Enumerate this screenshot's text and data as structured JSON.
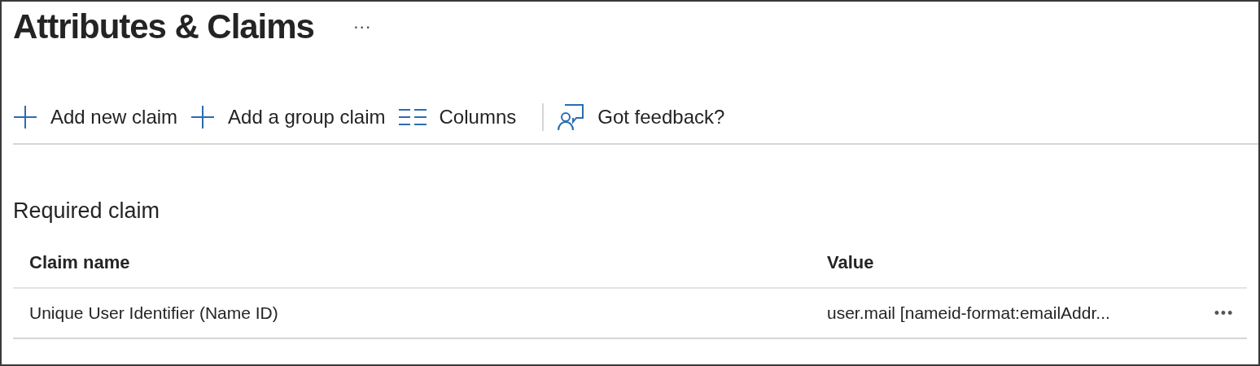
{
  "page": {
    "title": "Attributes & Claims",
    "more_menu": "···"
  },
  "toolbar": [
    {
      "kind": "add",
      "label": "Add new claim"
    },
    {
      "kind": "add",
      "label": "Add a group claim"
    },
    {
      "kind": "columns",
      "label": "Columns"
    },
    {
      "kind": "feedback",
      "label": "Got feedback?"
    }
  ],
  "section": {
    "title": "Required claim"
  },
  "table": {
    "columns": [
      "Claim name",
      "Value"
    ],
    "rows": [
      {
        "cells": [
          "Unique User Identifier (Name ID)",
          "user.mail [nameid-format:emailAddr..."
        ],
        "actions": "•••"
      }
    ]
  }
}
